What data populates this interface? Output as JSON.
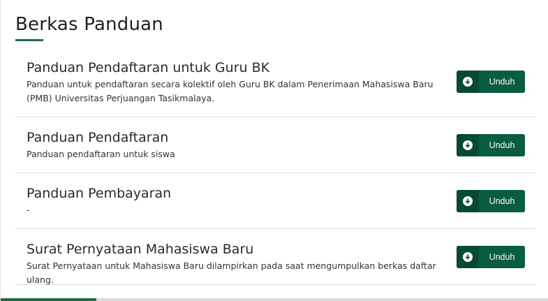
{
  "section": {
    "title": "Berkas Panduan"
  },
  "documents": [
    {
      "title": "Panduan Pendaftaran untuk Guru BK",
      "description": "Panduan untuk pendaftaran secara kolektif oleh Guru BK dalam Penerimaan Mahasiswa Baru (PMB) Universitas Perjuangan Tasikmalaya.",
      "button_label": "Unduh",
      "button_icon": "arrow-down-circle-icon"
    },
    {
      "title": "Panduan Pendaftaran",
      "description": "Panduan pendaftaran untuk siswa",
      "button_label": "Unduh",
      "button_icon": "arrow-down-circle-icon"
    },
    {
      "title": "Panduan Pembayaran",
      "description": "-",
      "button_label": "Unduh",
      "button_icon": "arrow-down-circle-icon"
    },
    {
      "title": "Surat Pernyataan Mahasiswa Baru",
      "description": "Surat Pernyataan untuk Mahasiswa Baru dilampirkan pada saat mengumpulkan berkas daftar ulang.",
      "button_label": "Unduh",
      "button_icon": "arrow-down-circle-icon"
    }
  ],
  "colors": {
    "accent": "#075d3e",
    "accent_dark": "#054a31"
  }
}
